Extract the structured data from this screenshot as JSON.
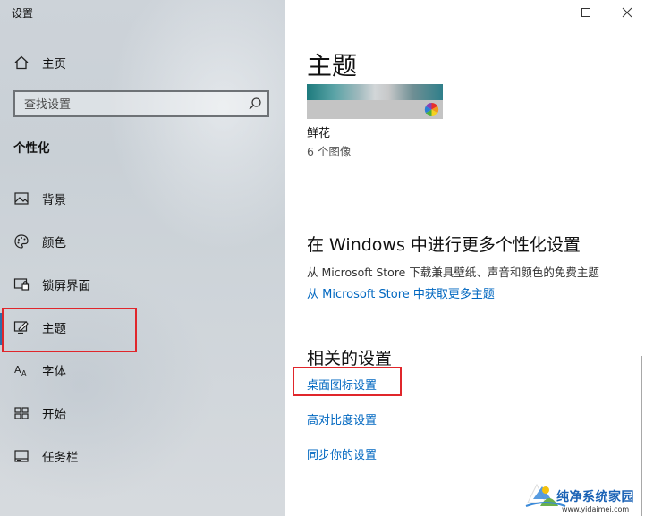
{
  "window": {
    "title": "设置"
  },
  "sidebar": {
    "home": {
      "label": "主页",
      "icon": "home-icon"
    },
    "search": {
      "placeholder": "查找设置",
      "icon": "search-icon"
    },
    "section": "个性化",
    "items": [
      {
        "label": "背景",
        "icon": "image-icon"
      },
      {
        "label": "颜色",
        "icon": "palette-icon"
      },
      {
        "label": "锁屏界面",
        "icon": "lock-screen-icon"
      },
      {
        "label": "主题",
        "icon": "theme-icon",
        "selected": true
      },
      {
        "label": "字体",
        "icon": "font-icon"
      },
      {
        "label": "开始",
        "icon": "start-icon"
      },
      {
        "label": "任务栏",
        "icon": "taskbar-icon"
      }
    ]
  },
  "main": {
    "title": "主题",
    "current_theme": {
      "name": "鲜花",
      "count": "6 个图像"
    },
    "store_section": {
      "heading": "在 Windows 中进行更多个性化设置",
      "description": "从 Microsoft Store 下载兼具壁纸、声音和颜色的免费主题",
      "link": "从 Microsoft Store 中获取更多主题"
    },
    "related": {
      "heading": "相关的设置",
      "links": [
        "桌面图标设置",
        "高对比度设置",
        "同步你的设置"
      ]
    }
  },
  "watermark": {
    "text": "纯净系统家园",
    "url": "www.yidaimei.com"
  },
  "colors": {
    "accent": "#0067c0",
    "highlight_box": "#e0262b",
    "selection_bar": "#2d6ea8"
  }
}
